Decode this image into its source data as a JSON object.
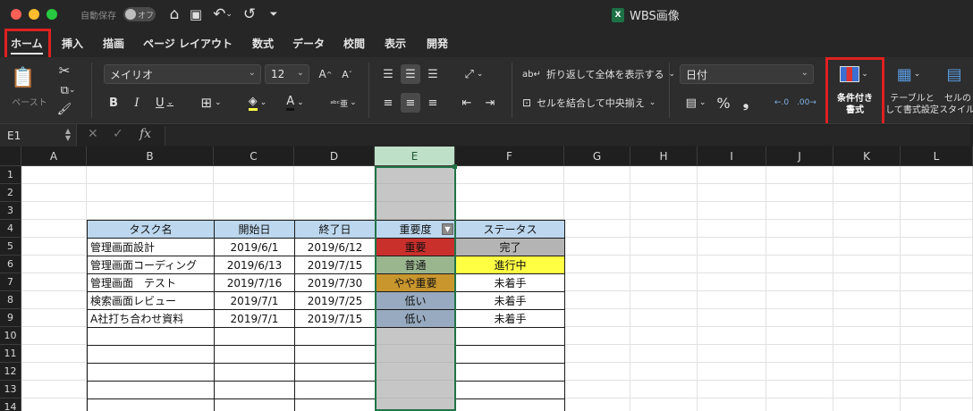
{
  "titlebar": {
    "autosave_label": "自動保存",
    "autosave_state": "オフ",
    "title": "WBS画像"
  },
  "tabs": [
    {
      "label": "ホーム",
      "active": true
    },
    {
      "label": "挿入"
    },
    {
      "label": "描画"
    },
    {
      "label": "ページ レイアウト"
    },
    {
      "label": "数式"
    },
    {
      "label": "データ"
    },
    {
      "label": "校閲"
    },
    {
      "label": "表示"
    },
    {
      "label": "開発"
    }
  ],
  "ribbon": {
    "paste_label": "ペースト",
    "font_name": "メイリオ",
    "font_size": "12",
    "wrap_text": "折り返して全体を表示する",
    "merge_center": "セルを結合して中央揃え",
    "number_format": "日付",
    "conditional_format": [
      "条件付き",
      "書式"
    ],
    "format_as_table": [
      "テーブルと",
      "して書式設定"
    ],
    "cell_styles": [
      "セルの",
      "スタイル"
    ]
  },
  "formula_bar": {
    "name_box": "E1",
    "fx": "fx",
    "formula": ""
  },
  "sheet": {
    "columns": [
      "A",
      "B",
      "C",
      "D",
      "E",
      "F",
      "G",
      "H",
      "I",
      "J",
      "K",
      "L"
    ],
    "rows": [
      "1",
      "2",
      "3",
      "4",
      "5",
      "6",
      "7",
      "8",
      "9",
      "10",
      "11",
      "12",
      "13",
      "14"
    ],
    "selected_column": "E",
    "table_header": [
      "タスク名",
      "開始日",
      "終了日",
      "重要度",
      "ステータス"
    ],
    "table_rows": [
      {
        "task": "管理画面設計",
        "start": "2019/6/1",
        "end": "2019/6/12",
        "priority": "重要",
        "status": "完了"
      },
      {
        "task": "管理画面コーディング",
        "start": "2019/6/13",
        "end": "2019/7/15",
        "priority": "普通",
        "status": "進行中"
      },
      {
        "task": "管理画面　テスト",
        "start": "2019/7/16",
        "end": "2019/7/30",
        "priority": "やや重要",
        "status": "未着手"
      },
      {
        "task": "検索画面レビュー",
        "start": "2019/7/1",
        "end": "2019/7/25",
        "priority": "低い",
        "status": "未着手"
      },
      {
        "task": "A社打ち合わせ資料",
        "start": "2019/7/1",
        "end": "2019/7/15",
        "priority": "低い",
        "status": "未着手"
      }
    ],
    "colors": {
      "header_fill": "#bcd7ee",
      "priority_high": "#c9302c",
      "priority_normal": "#9ab68f",
      "priority_medium": "#c9962e",
      "priority_low": "#97aabf",
      "status_done": "#b4b4b4",
      "status_in_progress": "#ffff44",
      "selected_column": "#c6c6c6",
      "highlight_box": "#e02020"
    }
  }
}
